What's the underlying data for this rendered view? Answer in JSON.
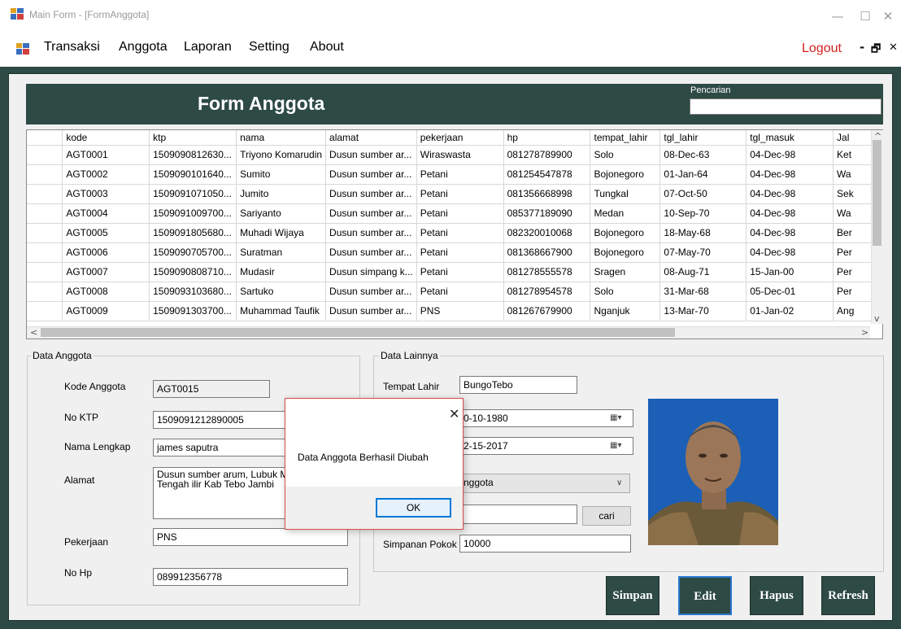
{
  "window": {
    "title": "Main Form - [FormAnggota]",
    "minimize": "—",
    "maximize": "☐",
    "close": "✕"
  },
  "menu": {
    "items": [
      "Transaksi",
      "Anggota",
      "Laporan",
      "Setting",
      "About"
    ],
    "logout": "Logout",
    "mdi_min": "-",
    "mdi_restore": "🗗",
    "mdi_close": "✕"
  },
  "form": {
    "title": "Form Anggota",
    "search_label": "Pencarian",
    "search_value": ""
  },
  "grid": {
    "columns": [
      "kode",
      "ktp",
      "nama",
      "alamat",
      "pekerjaan",
      "hp",
      "tempat_lahir",
      "tgl_lahir",
      "tgl_masuk",
      "Jal"
    ],
    "rows": [
      [
        "AGT0001",
        "1509090812630...",
        "Triyono Komarudin",
        "Dusun sumber ar...",
        "Wiraswasta",
        "081278789900",
        "Solo",
        "08-Dec-63",
        "04-Dec-98",
        "Ket"
      ],
      [
        "AGT0002",
        "1509090101640...",
        "Sumito",
        "Dusun sumber ar...",
        "Petani",
        "081254547878",
        "Bojonegoro",
        "01-Jan-64",
        "04-Dec-98",
        "Wa"
      ],
      [
        "AGT0003",
        "1509091071050...",
        "Jumito",
        "Dusun sumber ar...",
        "Petani",
        "081356668998",
        "Tungkal",
        "07-Oct-50",
        "04-Dec-98",
        "Sek"
      ],
      [
        "AGT0004",
        "1509091009700...",
        "Sariyanto",
        "Dusun sumber ar...",
        "Petani",
        "085377189090",
        "Medan",
        "10-Sep-70",
        "04-Dec-98",
        "Wa"
      ],
      [
        "AGT0005",
        "1509091805680...",
        "Muhadi Wijaya",
        "Dusun sumber ar...",
        "Petani",
        "082320010068",
        "Bojonegoro",
        "18-May-68",
        "04-Dec-98",
        "Ber"
      ],
      [
        "AGT0006",
        "1509090705700...",
        "Suratman",
        "Dusun sumber ar...",
        "Petani",
        "081368667900",
        "Bojonegoro",
        "07-May-70",
        "04-Dec-98",
        "Per"
      ],
      [
        "AGT0007",
        "1509090808710...",
        "Mudasir",
        "Dusun simpang k...",
        "Petani",
        "081278555578",
        "Sragen",
        "08-Aug-71",
        "15-Jan-00",
        "Per"
      ],
      [
        "AGT0008",
        "1509093103680...",
        "Sartuko",
        "Dusun sumber ar...",
        "Petani",
        "081278954578",
        "Solo",
        "31-Mar-68",
        "05-Dec-01",
        "Per"
      ],
      [
        "AGT0009",
        "1509091303700...",
        "Muhammad Taufik",
        "Dusun sumber ar...",
        "PNS",
        "081267679900",
        "Nganjuk",
        "13-Mar-70",
        "01-Jan-02",
        "Ang"
      ]
    ]
  },
  "data_anggota": {
    "title": "Data Anggota",
    "kode_label": "Kode Anggota",
    "kode_value": "AGT0015",
    "ktp_label": "No KTP",
    "ktp_value": "1509091212890005",
    "nama_label": "Nama Lengkap",
    "nama_value": "james saputra",
    "alamat_label": "Alamat",
    "alamat_line1": "Dusun sumber arum, Lubuk Ma",
    "alamat_line2": "Tengah ilir Kab Tebo Jambi",
    "pekerjaan_label": "Pekerjaan",
    "pekerjaan_value": "PNS",
    "hp_label": "No Hp",
    "hp_value": "089912356778"
  },
  "data_lainnya": {
    "title": "Data Lainnya",
    "tempat_lahir_label": "Tempat Lahir",
    "tempat_lahir_value": "BungoTebo",
    "tgl_lahir_value": "0-10-1980",
    "tgl_masuk_value": "2-15-2017",
    "status_value": "nggota",
    "cari_label": "cari",
    "simpanan_label": "Simpanan Pokok",
    "simpanan_value": "10000"
  },
  "actions": {
    "simpan": "Simpan",
    "edit": "Edit",
    "hapus": "Hapus",
    "refresh": "Refresh"
  },
  "dialog": {
    "message": "Data Anggota Berhasil Diubah",
    "ok": "OK",
    "close": "✕"
  },
  "colors": {
    "theme": "#2d4a44",
    "logout": "#d42020",
    "dialog_border": "#d64b4b",
    "photo_bg": "#1b5fb6"
  }
}
